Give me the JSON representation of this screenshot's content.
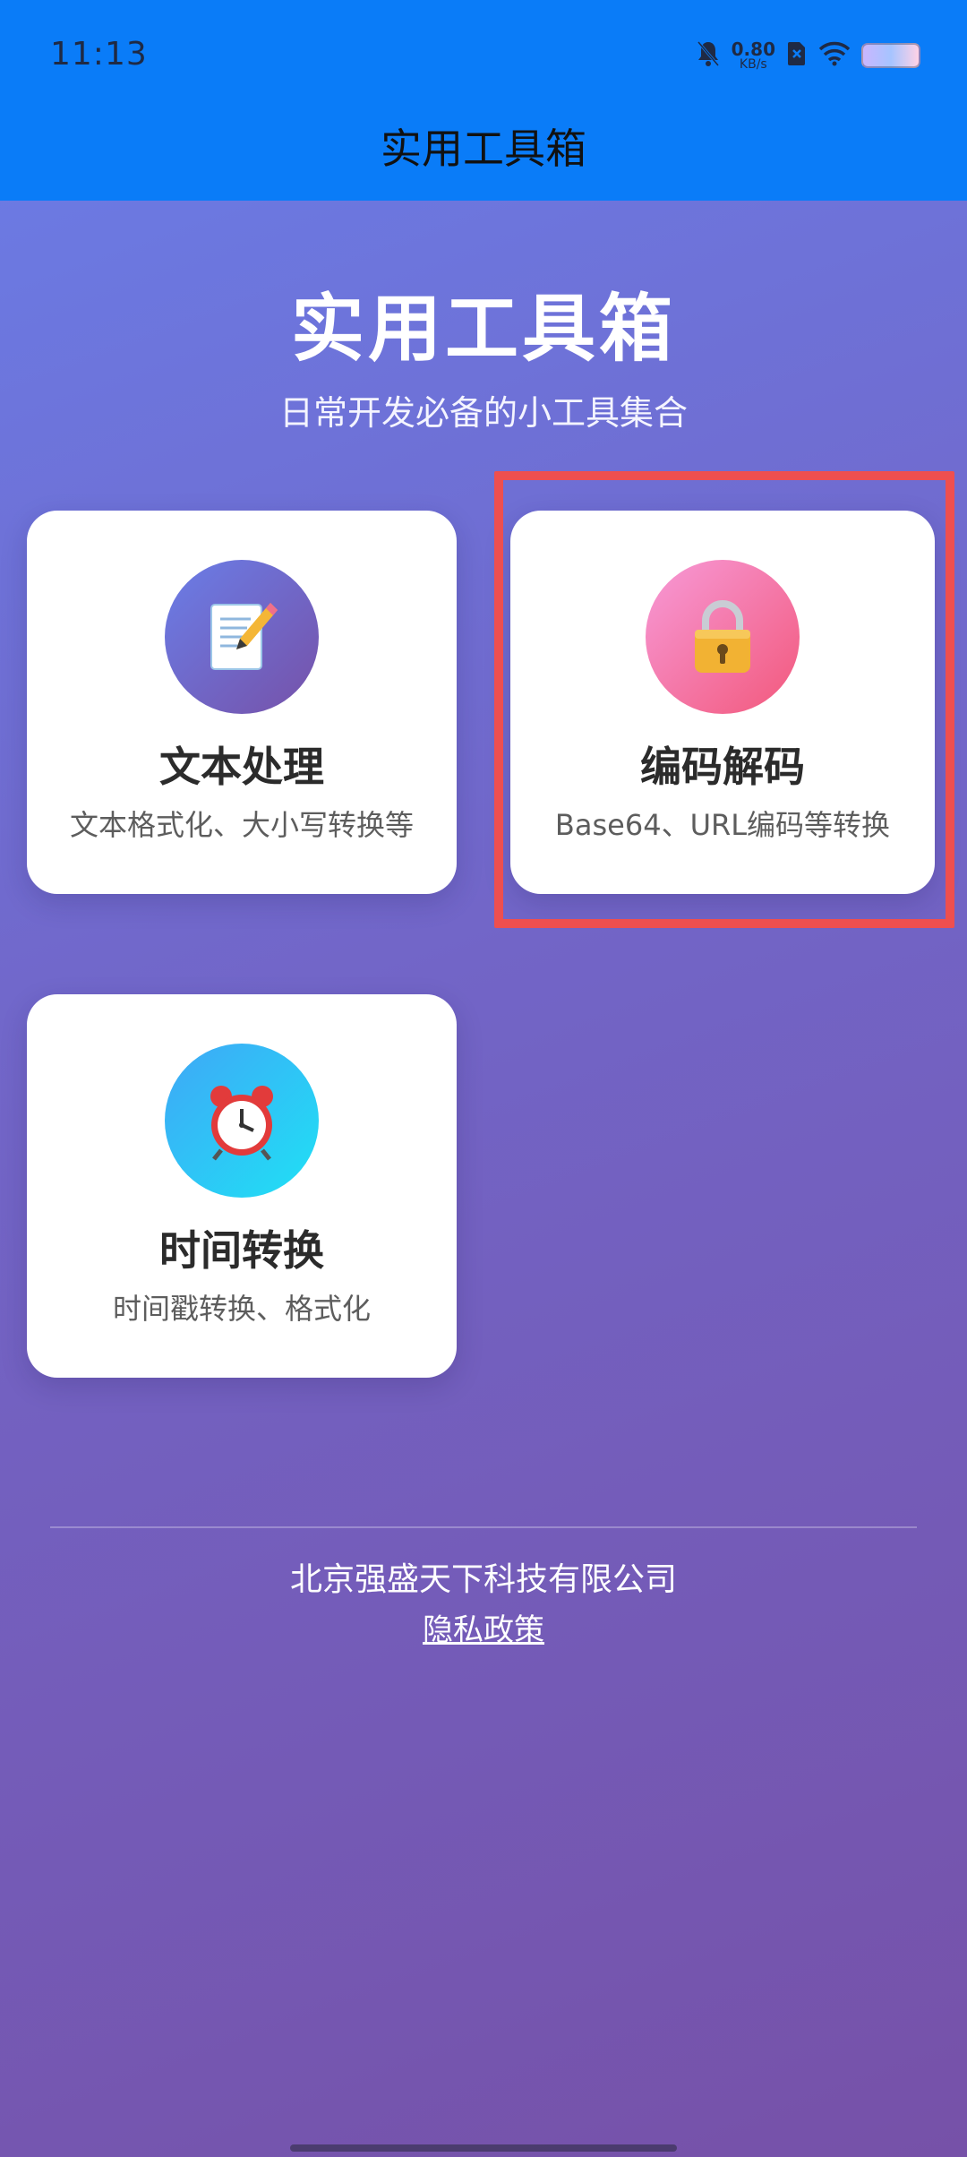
{
  "status_bar": {
    "time": "11:13",
    "net_speed_value": "0.80",
    "net_speed_unit": "KB/s",
    "icons": [
      "bell-muted-icon",
      "sim-icon",
      "wifi-icon",
      "battery-icon"
    ]
  },
  "app_bar": {
    "title": "实用工具箱"
  },
  "hero": {
    "title": "实用工具箱",
    "subtitle": "日常开发必备的小工具集合"
  },
  "tools": [
    {
      "icon": "memo-icon",
      "icon_glyph": "📝",
      "title": "文本处理",
      "desc": "文本格式化、大小写转换等"
    },
    {
      "icon": "lock-icon",
      "icon_glyph": "🔒",
      "title": "编码解码",
      "desc": "Base64、URL编码等转换"
    },
    {
      "icon": "alarm-clock-icon",
      "icon_glyph": "⏰",
      "title": "时间转换",
      "desc": "时间戳转换、格式化"
    }
  ],
  "footer": {
    "company": "北京强盛天下科技有限公司",
    "privacy_link": "隐私政策"
  },
  "colors": {
    "app_bar": "#0a7cf8",
    "background_start": "#6a7ee8",
    "background_end": "#7651a8",
    "highlight": "#ee4f4f",
    "card": "#ffffff"
  }
}
